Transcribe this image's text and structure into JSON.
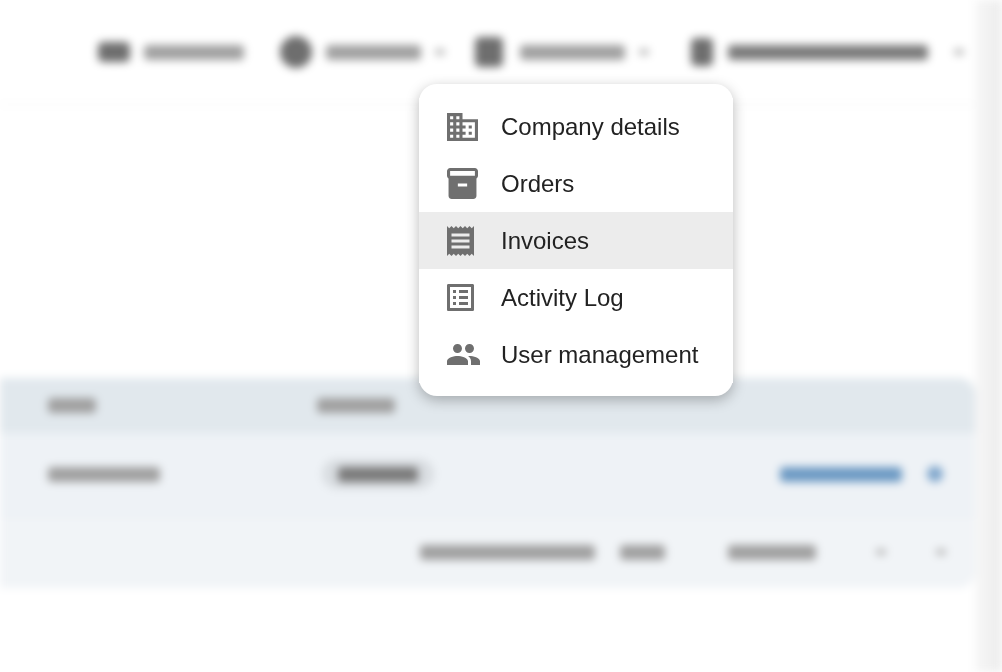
{
  "company_menu": {
    "items": [
      {
        "label": "Company details",
        "selected": false
      },
      {
        "label": "Orders",
        "selected": false
      },
      {
        "label": "Invoices",
        "selected": true
      },
      {
        "label": "Activity Log",
        "selected": false
      },
      {
        "label": "User management",
        "selected": false
      }
    ]
  }
}
